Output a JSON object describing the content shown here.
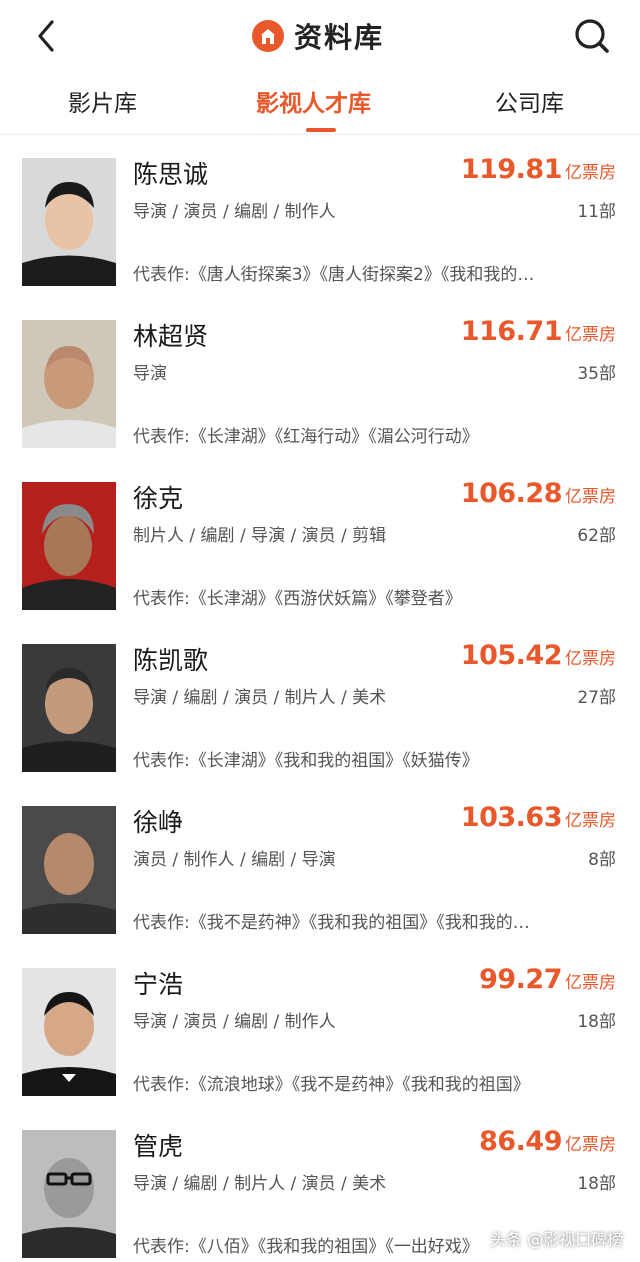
{
  "header": {
    "title": "资料库",
    "back_icon": "chevron-left-icon",
    "search_icon": "search-icon",
    "logo_icon": "database-logo-icon"
  },
  "tabs": [
    {
      "label": "影片库",
      "active": false
    },
    {
      "label": "影视人才库",
      "active": true
    },
    {
      "label": "公司库",
      "active": false
    }
  ],
  "colors": {
    "accent": "#e8582a"
  },
  "people": [
    {
      "name": "陈思诚",
      "roles": "导演 / 演员 / 编剧 / 制作人",
      "box_value": "119.81",
      "box_unit": "亿票房",
      "count": "11部",
      "works": "代表作:《唐人街探案3》《唐人街探案2》《我和我的…"
    },
    {
      "name": "林超贤",
      "roles": "导演",
      "box_value": "116.71",
      "box_unit": "亿票房",
      "count": "35部",
      "works": "代表作:《长津湖》《红海行动》《湄公河行动》"
    },
    {
      "name": "徐克",
      "roles": "制片人 / 编剧 / 导演 / 演员 / 剪辑",
      "box_value": "106.28",
      "box_unit": "亿票房",
      "count": "62部",
      "works": "代表作:《长津湖》《西游伏妖篇》《攀登者》"
    },
    {
      "name": "陈凯歌",
      "roles": "导演 / 编剧 / 演员 / 制片人 / 美术",
      "box_value": "105.42",
      "box_unit": "亿票房",
      "count": "27部",
      "works": "代表作:《长津湖》《我和我的祖国》《妖猫传》"
    },
    {
      "name": "徐峥",
      "roles": "演员 / 制作人 / 编剧 / 导演",
      "box_value": "103.63",
      "box_unit": "亿票房",
      "count": "8部",
      "works": "代表作:《我不是药神》《我和我的祖国》《我和我的…"
    },
    {
      "name": "宁浩",
      "roles": "导演 / 演员 / 编剧 / 制作人",
      "box_value": "99.27",
      "box_unit": "亿票房",
      "count": "18部",
      "works": "代表作:《流浪地球》《我不是药神》《我和我的祖国》"
    },
    {
      "name": "管虎",
      "roles": "导演 / 编剧 / 制片人 / 演员 / 美术",
      "box_value": "86.49",
      "box_unit": "亿票房",
      "count": "18部",
      "works": "代表作:《八佰》《我和我的祖国》《一出好戏》"
    }
  ],
  "watermark": "头条 @影视口碑榜"
}
